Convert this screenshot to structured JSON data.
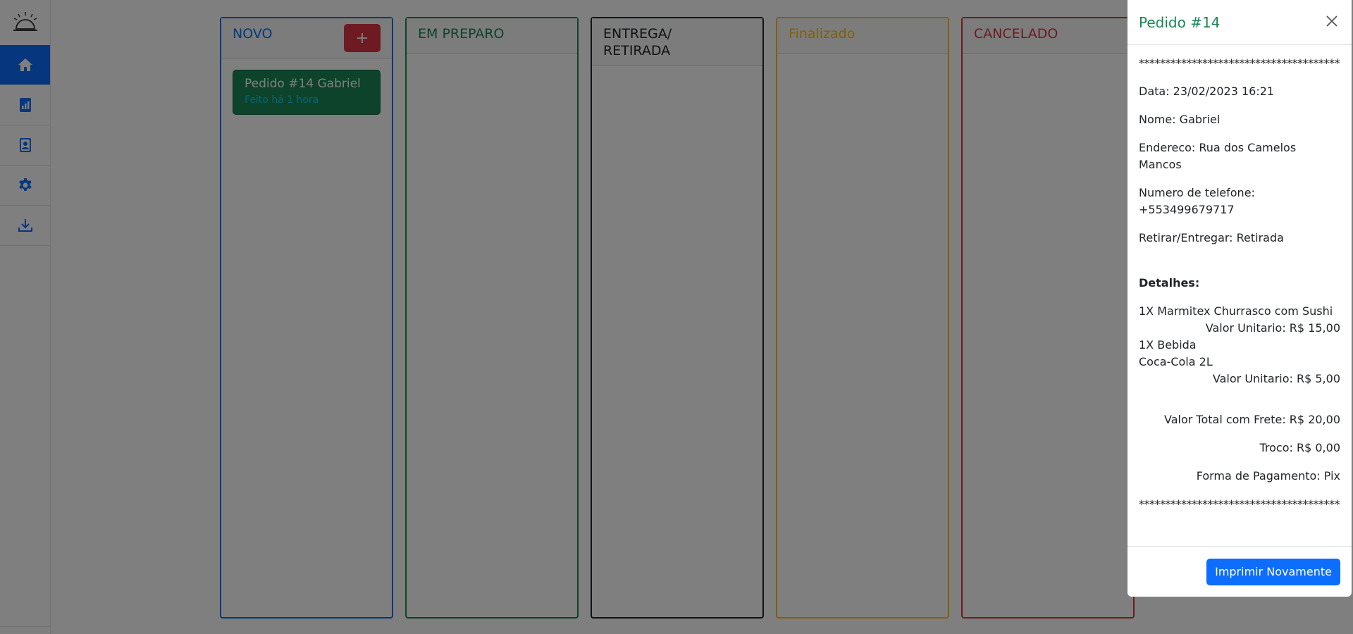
{
  "sidebar": {
    "items": [
      {
        "name": "home",
        "icon": "home-icon"
      },
      {
        "name": "reports",
        "icon": "chart-document-icon"
      },
      {
        "name": "contacts",
        "icon": "contact-card-icon"
      },
      {
        "name": "settings",
        "icon": "gear-icon"
      },
      {
        "name": "download",
        "icon": "download-icon"
      }
    ]
  },
  "board": {
    "columns": [
      {
        "title": "NOVO",
        "color": "#0d6efd"
      },
      {
        "title": "EM PREPARO",
        "color": "#198754"
      },
      {
        "title": "ENTREGA/ RETIRADA",
        "color": "#212529"
      },
      {
        "title": "Finalizado",
        "color": "#ffc107"
      },
      {
        "title": "CANCELADO",
        "color": "#dc3545"
      }
    ],
    "add_label": "+",
    "card": {
      "title": "Pedido #14 Gabriel",
      "time": "Feito há 1 hora"
    }
  },
  "modal": {
    "title": "Pedido #14",
    "stars": "****************************************",
    "date": "Data: 23/02/2023 16:21",
    "name": "Nome: Gabriel",
    "address": "Endereco: Rua dos Camelos Mancos",
    "phone": "Numero de telefone: +553499679717",
    "delivery": "Retirar/Entregar: Retirada",
    "details_label": "Detalhes:",
    "item1": "1X Marmitex Churrasco com Sushi",
    "item1_price": "Valor Unitario: R$ 15,00",
    "item2": "1X Bebida",
    "item2_detail": "Coca-Cola 2L",
    "item2_price": "Valor Unitario: R$ 5,00",
    "total": "Valor Total com Frete: R$ 20,00",
    "change": "Troco: R$ 0,00",
    "payment": "Forma de Pagamento: Pix",
    "print_label": "Imprimir Novamente"
  }
}
